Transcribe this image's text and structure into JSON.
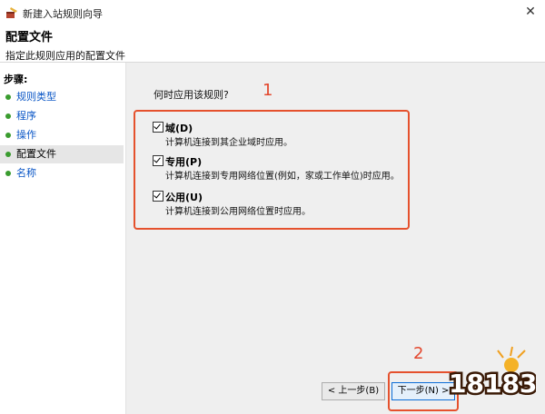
{
  "window": {
    "title": "新建入站规则向导",
    "close_glyph": "✕"
  },
  "header": {
    "title": "配置文件",
    "subtitle": "指定此规则应用的配置文件"
  },
  "sidebar": {
    "steps_label": "步骤:",
    "items": [
      {
        "label": "规则类型"
      },
      {
        "label": "程序"
      },
      {
        "label": "操作"
      },
      {
        "label": "配置文件"
      },
      {
        "label": "名称"
      }
    ]
  },
  "content": {
    "question": "何时应用该规则?",
    "options": [
      {
        "label": "域(D)",
        "desc": "计算机连接到其企业域时应用。",
        "checked": true
      },
      {
        "label": "专用(P)",
        "desc": "计算机连接到专用网络位置(例如，家或工作单位)时应用。",
        "checked": true
      },
      {
        "label": "公用(U)",
        "desc": "计算机连接到公用网络位置时应用。",
        "checked": true
      }
    ],
    "annotation_1": "1",
    "annotation_2": "2"
  },
  "buttons": {
    "back": "< 上一步(B)",
    "next": "下一步(N) >"
  },
  "watermark": {
    "text": "18183"
  },
  "colors": {
    "accent_red": "#e5512d",
    "link_blue": "#0a56c6",
    "step_dot": "#3a9c2f"
  }
}
